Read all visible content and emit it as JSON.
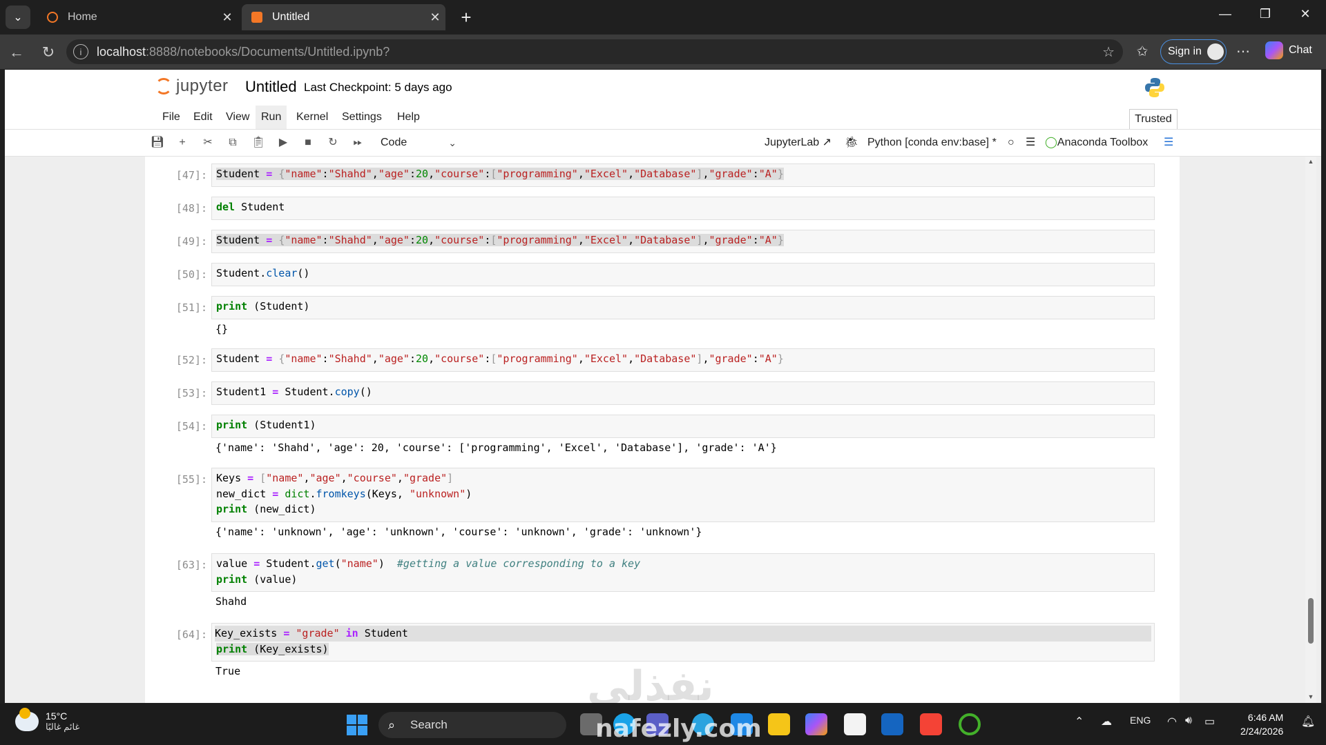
{
  "browser": {
    "tabs": [
      {
        "title": "Home",
        "active": false
      },
      {
        "title": "Untitled",
        "active": true
      }
    ],
    "url_host": "localhost",
    "url_rest": ":8888/notebooks/Documents/Untitled.ipynb?",
    "signin_label": "Sign in",
    "chat_label": "Chat"
  },
  "jupyter": {
    "logo_text": "jupyter",
    "notebook_title": "Untitled",
    "checkpoint": "Last Checkpoint: 5 days ago",
    "menu": [
      "File",
      "Edit",
      "View",
      "Run",
      "Kernel",
      "Settings",
      "Help"
    ],
    "active_menu": "Run",
    "trusted_label": "Trusted",
    "cell_type": "Code",
    "jupyterlab_link": "JupyterLab",
    "kernel_label": "Python [conda env:base] *",
    "anaconda_label": "Anaconda Toolbox"
  },
  "cells": [
    {
      "prompt": "[47]:",
      "input": "Student = {\"name\":\"Shahd\",\"age\":20,\"course\":[\"programming\",\"Excel\",\"Database\"],\"grade\":\"A\"}",
      "output": ""
    },
    {
      "prompt": "[48]:",
      "input": "del Student",
      "output": ""
    },
    {
      "prompt": "[49]:",
      "input": "Student = {\"name\":\"Shahd\",\"age\":20,\"course\":[\"programming\",\"Excel\",\"Database\"],\"grade\":\"A\"}",
      "output": ""
    },
    {
      "prompt": "[50]:",
      "input": "Student.clear()",
      "output": ""
    },
    {
      "prompt": "[51]:",
      "input": "print (Student)",
      "output": "{}"
    },
    {
      "prompt": "[52]:",
      "input": "Student = {\"name\":\"Shahd\",\"age\":20,\"course\":[\"programming\",\"Excel\",\"Database\"],\"grade\":\"A\"}",
      "output": ""
    },
    {
      "prompt": "[53]:",
      "input": "Student1 = Student.copy()",
      "output": ""
    },
    {
      "prompt": "[54]:",
      "input": "print (Student1)",
      "output": "{'name': 'Shahd', 'age': 20, 'course': ['programming', 'Excel', 'Database'], 'grade': 'A'}"
    },
    {
      "prompt": "[55]:",
      "input": "Keys = [\"name\",\"age\",\"course\",\"grade\"]\nnew_dict = dict.fromkeys(Keys, \"unknown\")\nprint (new_dict)",
      "output": "{'name': 'unknown', 'age': 'unknown', 'course': 'unknown', 'grade': 'unknown'}"
    },
    {
      "prompt": "[63]:",
      "input": "value = Student.get(\"name\")  #getting a value corresponding to a key\nprint (value)",
      "output": "Shahd"
    },
    {
      "prompt": "[64]:",
      "input": "Key_exists = \"grade\" in Student\nprint (Key_exists)",
      "output": "True"
    }
  ],
  "taskbar": {
    "temperature": "15°C",
    "weather_text": "غائم غالبًا",
    "search_label": "Search",
    "language": "ENG",
    "time": "6:46 AM",
    "date": "2/24/2026"
  },
  "watermark": {
    "arabic": "نفذلي",
    "latin": "nafezly.com"
  },
  "colors": {
    "jupyter_orange": "#f37726",
    "accent_blue": "#4a90e2",
    "keyword_green": "#008000",
    "string_red": "#ba2121",
    "operator_purple": "#aa22ff"
  }
}
